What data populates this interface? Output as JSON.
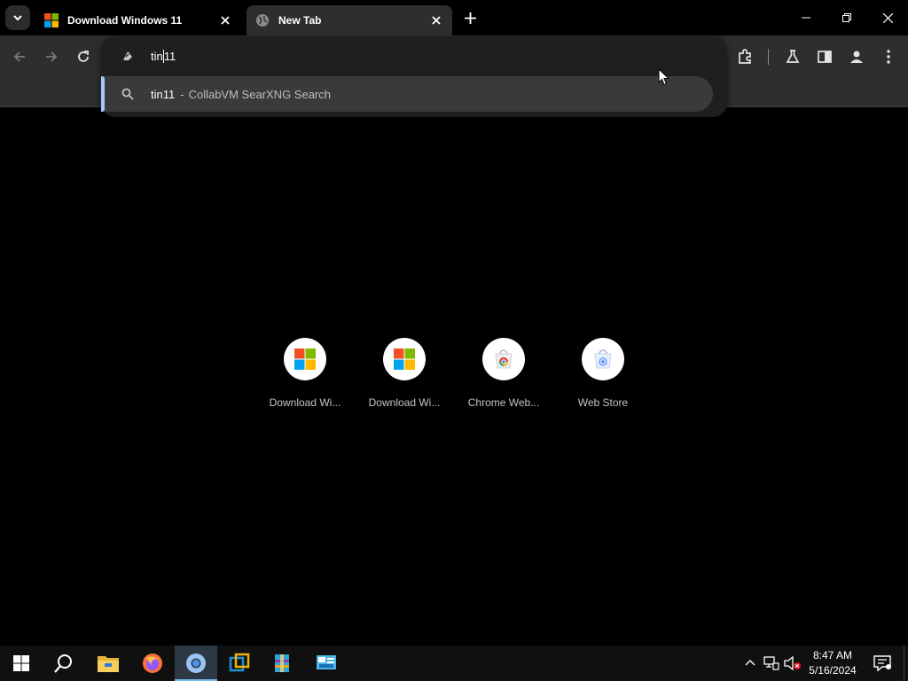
{
  "tabs": [
    {
      "title": "Download Windows 11",
      "active": false
    },
    {
      "title": "New Tab",
      "active": true
    }
  ],
  "omnibox": {
    "typed_before_caret": "tin",
    "typed_after_caret": "11",
    "suggestion_query": "tin11",
    "suggestion_separator": "-",
    "suggestion_description": "CollabVM SearXNG Search"
  },
  "shortcuts": [
    {
      "title": "Download Wi...",
      "icon": "microsoft-logo-icon"
    },
    {
      "title": "Download Wi...",
      "icon": "microsoft-logo-icon"
    },
    {
      "title": "Chrome Web...",
      "icon": "chrome-web-store-icon"
    },
    {
      "title": "Web Store",
      "icon": "chrome-web-store-icon"
    }
  ],
  "taskbar": {
    "apps": [
      "start-icon",
      "search-icon",
      "file-explorer-icon",
      "firefox-icon",
      "chrome-icon",
      "virtualbox-icon",
      "winrar-icon",
      "control-panel-icon"
    ],
    "clock_time": "8:47 AM",
    "clock_date": "5/16/2024"
  },
  "colors": {
    "toolbar": "#2e2e2e",
    "popup": "#1f1f1f",
    "suggestion_focus": "#a8c7fa",
    "taskbar": "#101010",
    "taskbar_active": "#76b9ed"
  }
}
